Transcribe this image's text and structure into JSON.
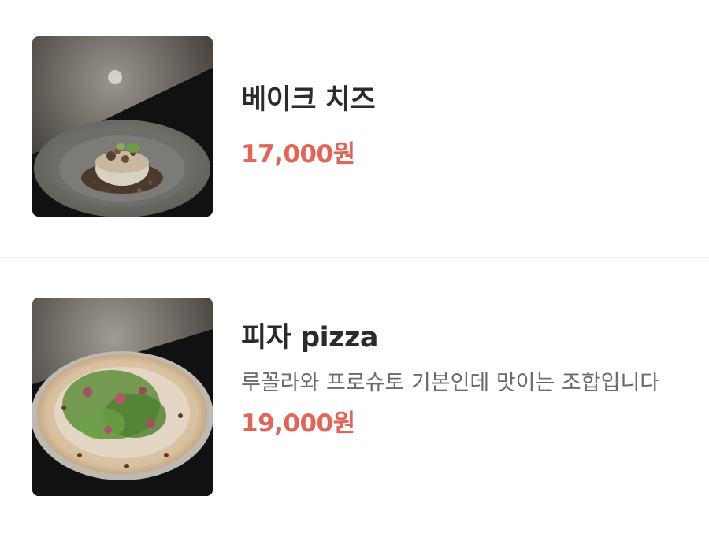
{
  "menu": {
    "items": [
      {
        "name": "베이크 치즈",
        "description": "",
        "price": "17,000원",
        "image_icon": "baked-cheese-photo"
      },
      {
        "name": "피자 pizza",
        "description": "루꼴라와 프로슈토 기본인데 맛이는 조합입니다",
        "price": "19,000원",
        "image_icon": "pizza-photo"
      }
    ]
  },
  "colors": {
    "price": "#e0665a",
    "divider": "#ececec",
    "title": "#2b2b2b",
    "description": "#6b6b6b"
  }
}
